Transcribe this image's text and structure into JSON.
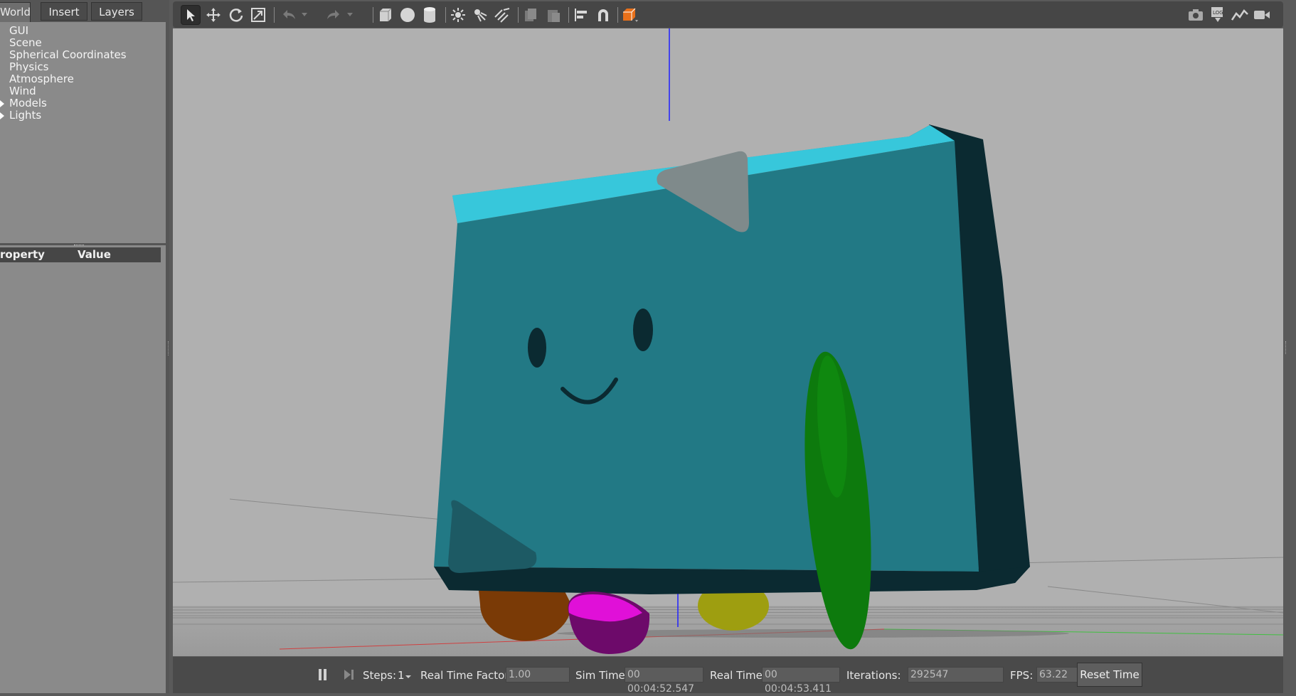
{
  "left_panel": {
    "tabs": [
      "World",
      "Insert",
      "Layers"
    ],
    "tree_items": [
      "GUI",
      "Scene",
      "Spherical Coordinates",
      "Physics",
      "Atmosphere",
      "Wind",
      "Models",
      "Lights"
    ],
    "property_headers": {
      "property": "roperty",
      "value": "Value"
    }
  },
  "toolbar": {
    "left_icons": [
      "select-arrow-icon",
      "translate-icon",
      "rotate-icon",
      "scale-icon",
      "undo-icon",
      "undo-dropdown-icon",
      "redo-icon",
      "redo-dropdown-icon",
      "box-shape-icon",
      "sphere-shape-icon",
      "cylinder-shape-icon",
      "point-light-icon",
      "spot-light-icon",
      "directional-light-icon",
      "copy-icon",
      "paste-icon",
      "align-icon",
      "snap-icon",
      "view-angle-icon"
    ],
    "right_icons": [
      "screenshot-icon",
      "log-icon",
      "plot-icon",
      "video-record-icon"
    ]
  },
  "bottom_bar": {
    "steps_label": "Steps:",
    "steps_value": "1",
    "rtf_label": "Real Time Factor:",
    "rtf_value": "1.00",
    "sim_time_label": "Sim Time:",
    "sim_time_value": "00 00:04:52.547",
    "real_time_label": "Real Time:",
    "real_time_value": "00 00:04:53.411",
    "iterations_label": "Iterations:",
    "iterations_value": "292547",
    "fps_label": "FPS:",
    "fps_value": "63.22",
    "reset_label": "Reset Time"
  },
  "colors": {
    "viewport_bg": "#b0b0b0",
    "robot_front": "#227985",
    "robot_top": "#37c7db",
    "robot_side": "#0b2a31",
    "wheel_green": "#0d7a0d",
    "caster_magenta": "#e010d8",
    "caster_brown": "#7a3a06",
    "caster_yellow": "#a0a010"
  }
}
